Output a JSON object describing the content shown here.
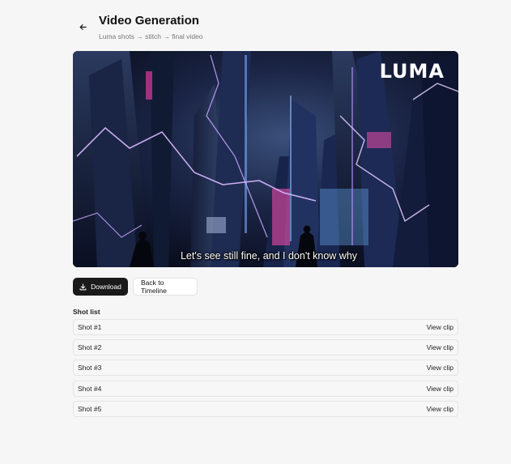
{
  "header": {
    "title": "Video Generation",
    "subtitle": "Luma shots → stitch → final video"
  },
  "video": {
    "brand": "LUMA",
    "caption": "Let's see still fine, and I don't know why"
  },
  "actions": {
    "download_label": "Download",
    "back_label": "Back to Timeline"
  },
  "shot_list": {
    "heading": "Shot list",
    "action_label": "View clip",
    "items": [
      {
        "label": "Shot #1"
      },
      {
        "label": "Shot #2"
      },
      {
        "label": "Shot #3"
      },
      {
        "label": "Shot #4"
      },
      {
        "label": "Shot #5"
      }
    ]
  },
  "colors": {
    "primary_button": "#1a1a1a",
    "page_background": "#f6f6f6"
  }
}
